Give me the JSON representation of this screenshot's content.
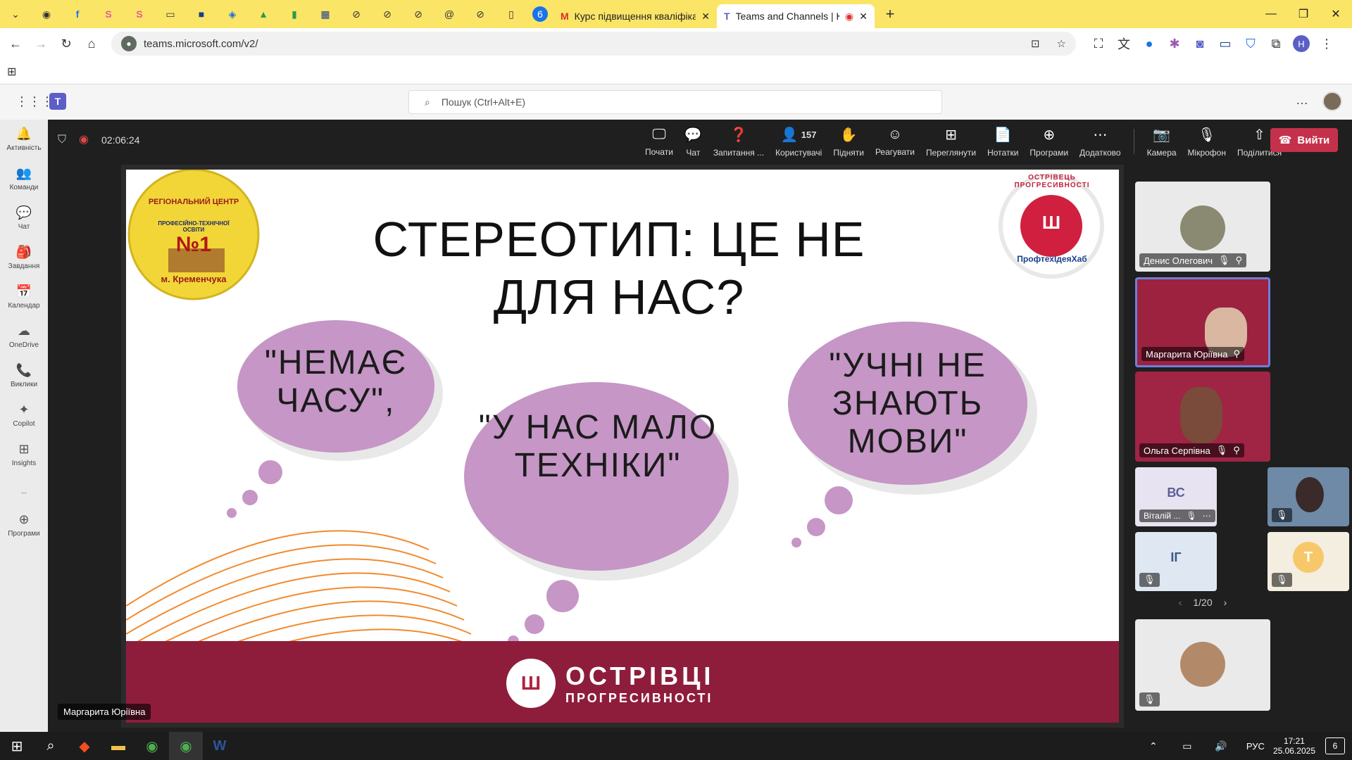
{
  "browser": {
    "tabs": [
      {
        "label": "Курс підвищення кваліфікаці",
        "active": false
      },
      {
        "label": "Teams and Channels | Курс",
        "active": true
      }
    ],
    "url": "teams.microsoft.com/v2/",
    "new_tab": "+",
    "profile_initial": "Н"
  },
  "teams": {
    "search_placeholder": "Пошук (Ctrl+Alt+E)",
    "more": "…"
  },
  "rail": {
    "items": [
      {
        "label": "Активність",
        "icon": "bell-icon",
        "glyph": "🔔"
      },
      {
        "label": "Команди",
        "icon": "teams-icon",
        "glyph": "👥"
      },
      {
        "label": "Чат",
        "icon": "chat-icon",
        "glyph": "💬"
      },
      {
        "label": "Завдання",
        "icon": "assignments-icon",
        "glyph": "🎒"
      },
      {
        "label": "Календар",
        "icon": "calendar-icon",
        "glyph": "📅"
      },
      {
        "label": "OneDrive",
        "icon": "cloud-icon",
        "glyph": "☁"
      },
      {
        "label": "Виклики",
        "icon": "phone-icon",
        "glyph": "📞"
      },
      {
        "label": "Copilot",
        "icon": "copilot-icon",
        "glyph": "✦"
      },
      {
        "label": "Insights",
        "icon": "insights-icon",
        "glyph": "⊞"
      },
      {
        "label": "...",
        "icon": "more-icon",
        "glyph": ""
      },
      {
        "label": "Програми",
        "icon": "apps-icon",
        "glyph": "⊕"
      }
    ]
  },
  "meeting": {
    "timer": "02:06:24",
    "toolbar": [
      {
        "label": "Почати",
        "icon": "screen-icon",
        "glyph": "🖵"
      },
      {
        "label": "Чат",
        "icon": "chat-icon",
        "glyph": "💬"
      },
      {
        "label": "Запитання ...",
        "icon": "qa-icon",
        "glyph": "❓"
      },
      {
        "label": "Користувачі",
        "icon": "people-icon",
        "glyph": "👤",
        "count": "157"
      },
      {
        "label": "Підняти",
        "icon": "hand-icon",
        "glyph": "✋"
      },
      {
        "label": "Реагувати",
        "icon": "smile-icon",
        "glyph": "☺"
      },
      {
        "label": "Переглянути",
        "icon": "grid-icon",
        "glyph": "⊞"
      },
      {
        "label": "Нотатки",
        "icon": "notes-icon",
        "glyph": "📄"
      },
      {
        "label": "Програми",
        "icon": "apps-icon",
        "glyph": "⊕"
      },
      {
        "label": "Додатково",
        "icon": "more-icon",
        "glyph": "⋯"
      },
      {
        "label": "Камера",
        "icon": "camera-off-icon",
        "glyph": "📷"
      },
      {
        "label": "Мікрофон",
        "icon": "mic-off-icon",
        "glyph": "🎙"
      },
      {
        "label": "Поділитися",
        "icon": "share-icon",
        "glyph": "⇧"
      }
    ],
    "leave_label": "Вийти",
    "speaker_name": "Маргарита Юріївна"
  },
  "slide": {
    "title": "СТЕРЕОТИП: ЦЕ НЕ ДЛЯ НАС?",
    "bubbles": [
      "\"НЕМАЄ ЧАСУ\",",
      "\"У НАС МАЛО ТЕХНІКИ\"",
      "\"УЧНІ НЕ ЗНАЮТЬ МОВИ\""
    ],
    "left_logo": {
      "line1": "РЕГІОНАЛЬНИЙ ЦЕНТР",
      "line2": "ПРОФЕСІЙНО-ТЕХНІЧНОЇ ОСВІТИ",
      "num": "№1",
      "line3": "м. Кременчука"
    },
    "right_logo": {
      "ring": "ОСТРІВЕЦЬ ПРОГРЕСИВНОСТІ",
      "sub": "ПрофтехІдеяХаб"
    },
    "footer": {
      "line1": "ОСТРІВЦІ",
      "line2": "ПРОГРЕСИВНОСТІ"
    },
    "colors": {
      "bubble": "#c596c6",
      "band": "#8e1d3c",
      "orange": "#f28a2e"
    }
  },
  "participants": [
    {
      "name": "Денис Олегович"
    },
    {
      "name": "Маргарита Юріївна"
    },
    {
      "name": "Ольга Серпівна"
    },
    {
      "name": "Віталій ...",
      "initials": "ВС"
    },
    {
      "name": ""
    },
    {
      "initials": "ІГ"
    },
    {
      "initials": "Т"
    },
    {
      "name": ""
    }
  ],
  "pager": "1/20",
  "taskbar": {
    "lang": "РУС",
    "time": "17:21",
    "date": "25.06.2025",
    "notif": "6"
  }
}
